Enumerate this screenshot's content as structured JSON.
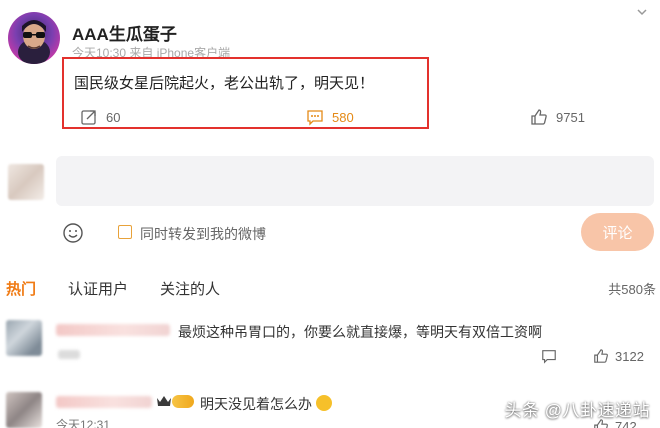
{
  "post": {
    "username": "AAA生瓜蛋子",
    "meta": "今天10:30 来自 iPhone客户端",
    "text": "国民级女星后院起火，老公出轨了，明天见！",
    "reposts": "60",
    "comments": "580",
    "likes": "9751"
  },
  "composer": {
    "repost_label": "同时转发到我的微博",
    "submit_label": "评论"
  },
  "tabs": [
    {
      "label": "热门",
      "active": true
    },
    {
      "label": "认证用户"
    },
    {
      "label": "关注的人"
    }
  ],
  "total_comments": "共580条",
  "comments": [
    {
      "text": "最烦这种吊胃口的，你要么就直接爆，等明天有双倍工资啊",
      "likes": "3122"
    },
    {
      "text": "明天没见着怎么办",
      "time": "今天12:31",
      "likes": "742"
    }
  ],
  "colors": {
    "accent": "#f07b14",
    "highlight_box": "#e3312d",
    "button": "#f8c5a8"
  },
  "watermark": "头条 @八卦速递站"
}
